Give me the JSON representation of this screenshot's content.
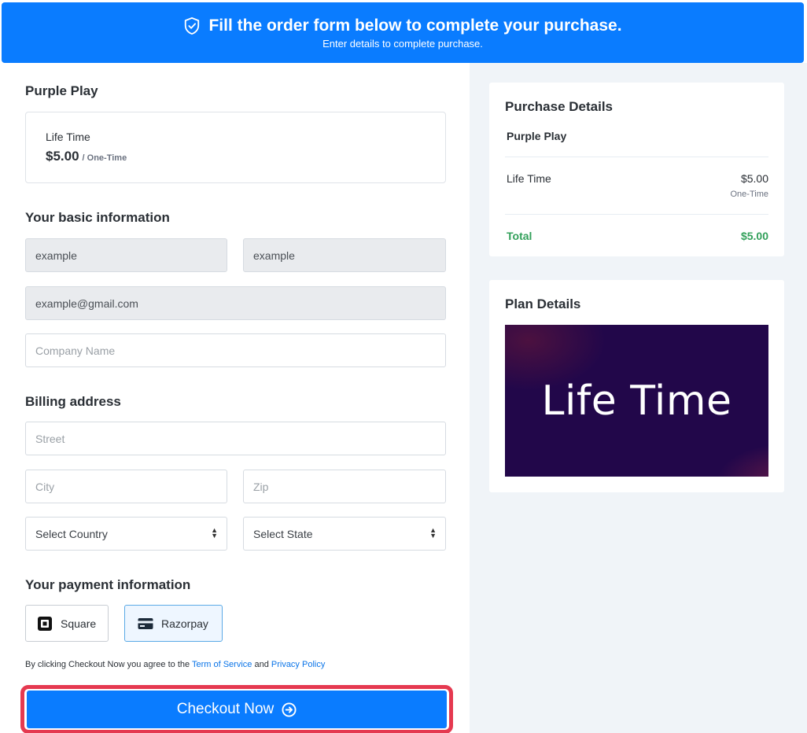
{
  "header": {
    "title": "Fill the order form below to complete your purchase.",
    "subtitle": "Enter details to complete purchase."
  },
  "product": {
    "name": "Purple Play",
    "plan_name": "Life Time",
    "price": "$5.00",
    "period": "/ One-Time"
  },
  "basic_info": {
    "heading": "Your basic information",
    "first_name": "example",
    "last_name": "example",
    "email": "example@gmail.com",
    "company_placeholder": "Company Name"
  },
  "billing": {
    "heading": "Billing address",
    "street_placeholder": "Street",
    "city_placeholder": "City",
    "zip_placeholder": "Zip",
    "country_selected": "Select Country",
    "state_selected": "Select State"
  },
  "payment": {
    "heading": "Your payment information",
    "methods": [
      {
        "label": "Square",
        "icon": "square-logo-icon",
        "selected": false
      },
      {
        "label": "Razorpay",
        "icon": "credit-card-icon",
        "selected": true
      }
    ]
  },
  "terms": {
    "prefix": "By clicking Checkout Now you agree to the",
    "tos": "Term of Service",
    "and": "and",
    "privacy": "Privacy Policy"
  },
  "checkout": {
    "label": "Checkout Now",
    "icon": "arrow-circle-right-icon",
    "color": "#0a7cff",
    "highlight_color": "#e53950"
  },
  "purchase_details": {
    "heading": "Purchase Details",
    "product": "Purple Play",
    "item": "Life Time",
    "item_price": "$5.00",
    "item_period": "One-Time",
    "total_label": "Total",
    "total_value": "$5.00",
    "total_color": "#32a05a"
  },
  "plan_details": {
    "heading": "Plan Details",
    "image_text": "Life Time"
  },
  "colors": {
    "accent": "#0a7cff",
    "sidebar_bg": "#f0f4f8"
  }
}
